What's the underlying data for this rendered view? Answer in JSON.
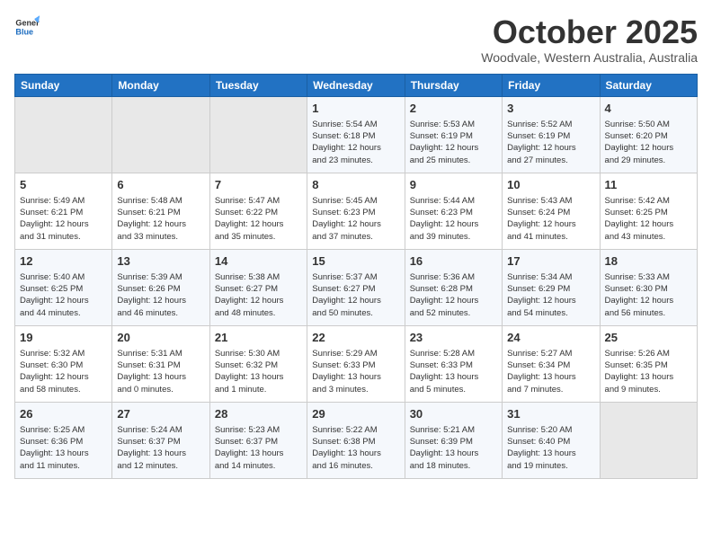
{
  "logo": {
    "general": "General",
    "blue": "Blue"
  },
  "header": {
    "title": "October 2025",
    "subtitle": "Woodvale, Western Australia, Australia"
  },
  "weekdays": [
    "Sunday",
    "Monday",
    "Tuesday",
    "Wednesday",
    "Thursday",
    "Friday",
    "Saturday"
  ],
  "weeks": [
    [
      {
        "day": "",
        "info": ""
      },
      {
        "day": "",
        "info": ""
      },
      {
        "day": "",
        "info": ""
      },
      {
        "day": "1",
        "info": "Sunrise: 5:54 AM\nSunset: 6:18 PM\nDaylight: 12 hours\nand 23 minutes."
      },
      {
        "day": "2",
        "info": "Sunrise: 5:53 AM\nSunset: 6:19 PM\nDaylight: 12 hours\nand 25 minutes."
      },
      {
        "day": "3",
        "info": "Sunrise: 5:52 AM\nSunset: 6:19 PM\nDaylight: 12 hours\nand 27 minutes."
      },
      {
        "day": "4",
        "info": "Sunrise: 5:50 AM\nSunset: 6:20 PM\nDaylight: 12 hours\nand 29 minutes."
      }
    ],
    [
      {
        "day": "5",
        "info": "Sunrise: 5:49 AM\nSunset: 6:21 PM\nDaylight: 12 hours\nand 31 minutes."
      },
      {
        "day": "6",
        "info": "Sunrise: 5:48 AM\nSunset: 6:21 PM\nDaylight: 12 hours\nand 33 minutes."
      },
      {
        "day": "7",
        "info": "Sunrise: 5:47 AM\nSunset: 6:22 PM\nDaylight: 12 hours\nand 35 minutes."
      },
      {
        "day": "8",
        "info": "Sunrise: 5:45 AM\nSunset: 6:23 PM\nDaylight: 12 hours\nand 37 minutes."
      },
      {
        "day": "9",
        "info": "Sunrise: 5:44 AM\nSunset: 6:23 PM\nDaylight: 12 hours\nand 39 minutes."
      },
      {
        "day": "10",
        "info": "Sunrise: 5:43 AM\nSunset: 6:24 PM\nDaylight: 12 hours\nand 41 minutes."
      },
      {
        "day": "11",
        "info": "Sunrise: 5:42 AM\nSunset: 6:25 PM\nDaylight: 12 hours\nand 43 minutes."
      }
    ],
    [
      {
        "day": "12",
        "info": "Sunrise: 5:40 AM\nSunset: 6:25 PM\nDaylight: 12 hours\nand 44 minutes."
      },
      {
        "day": "13",
        "info": "Sunrise: 5:39 AM\nSunset: 6:26 PM\nDaylight: 12 hours\nand 46 minutes."
      },
      {
        "day": "14",
        "info": "Sunrise: 5:38 AM\nSunset: 6:27 PM\nDaylight: 12 hours\nand 48 minutes."
      },
      {
        "day": "15",
        "info": "Sunrise: 5:37 AM\nSunset: 6:27 PM\nDaylight: 12 hours\nand 50 minutes."
      },
      {
        "day": "16",
        "info": "Sunrise: 5:36 AM\nSunset: 6:28 PM\nDaylight: 12 hours\nand 52 minutes."
      },
      {
        "day": "17",
        "info": "Sunrise: 5:34 AM\nSunset: 6:29 PM\nDaylight: 12 hours\nand 54 minutes."
      },
      {
        "day": "18",
        "info": "Sunrise: 5:33 AM\nSunset: 6:30 PM\nDaylight: 12 hours\nand 56 minutes."
      }
    ],
    [
      {
        "day": "19",
        "info": "Sunrise: 5:32 AM\nSunset: 6:30 PM\nDaylight: 12 hours\nand 58 minutes."
      },
      {
        "day": "20",
        "info": "Sunrise: 5:31 AM\nSunset: 6:31 PM\nDaylight: 13 hours\nand 0 minutes."
      },
      {
        "day": "21",
        "info": "Sunrise: 5:30 AM\nSunset: 6:32 PM\nDaylight: 13 hours\nand 1 minute."
      },
      {
        "day": "22",
        "info": "Sunrise: 5:29 AM\nSunset: 6:33 PM\nDaylight: 13 hours\nand 3 minutes."
      },
      {
        "day": "23",
        "info": "Sunrise: 5:28 AM\nSunset: 6:33 PM\nDaylight: 13 hours\nand 5 minutes."
      },
      {
        "day": "24",
        "info": "Sunrise: 5:27 AM\nSunset: 6:34 PM\nDaylight: 13 hours\nand 7 minutes."
      },
      {
        "day": "25",
        "info": "Sunrise: 5:26 AM\nSunset: 6:35 PM\nDaylight: 13 hours\nand 9 minutes."
      }
    ],
    [
      {
        "day": "26",
        "info": "Sunrise: 5:25 AM\nSunset: 6:36 PM\nDaylight: 13 hours\nand 11 minutes."
      },
      {
        "day": "27",
        "info": "Sunrise: 5:24 AM\nSunset: 6:37 PM\nDaylight: 13 hours\nand 12 minutes."
      },
      {
        "day": "28",
        "info": "Sunrise: 5:23 AM\nSunset: 6:37 PM\nDaylight: 13 hours\nand 14 minutes."
      },
      {
        "day": "29",
        "info": "Sunrise: 5:22 AM\nSunset: 6:38 PM\nDaylight: 13 hours\nand 16 minutes."
      },
      {
        "day": "30",
        "info": "Sunrise: 5:21 AM\nSunset: 6:39 PM\nDaylight: 13 hours\nand 18 minutes."
      },
      {
        "day": "31",
        "info": "Sunrise: 5:20 AM\nSunset: 6:40 PM\nDaylight: 13 hours\nand 19 minutes."
      },
      {
        "day": "",
        "info": ""
      }
    ]
  ]
}
